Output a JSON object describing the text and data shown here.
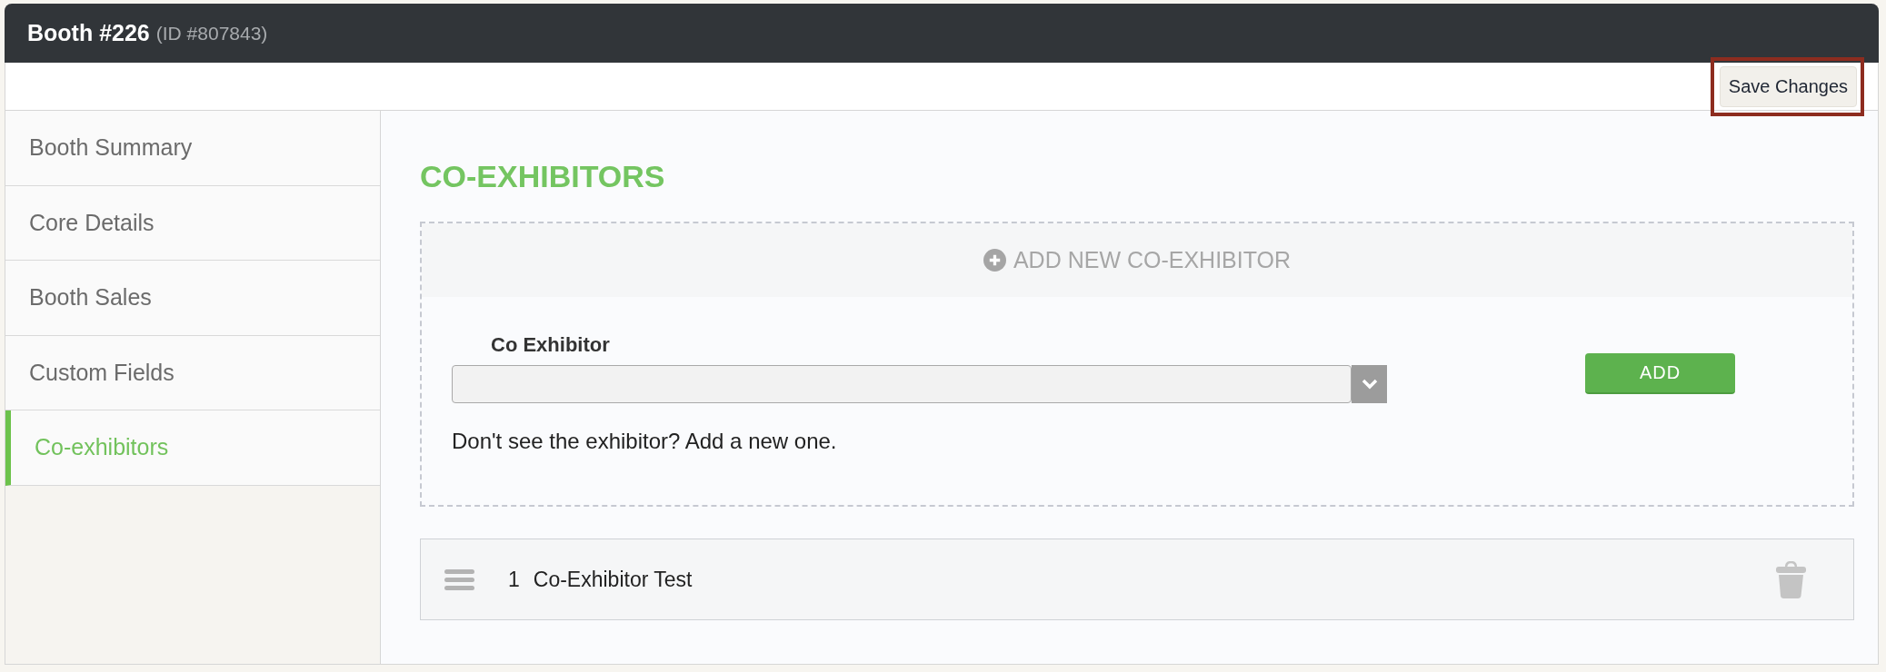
{
  "header": {
    "title": "Booth #226",
    "id_label": "(ID #807843)"
  },
  "save_button": {
    "label": "Save Changes",
    "highlighted": true
  },
  "sidebar": {
    "items": [
      {
        "label": "Booth Summary",
        "selected": false
      },
      {
        "label": "Core Details",
        "selected": false
      },
      {
        "label": "Booth Sales",
        "selected": false
      },
      {
        "label": "Custom Fields",
        "selected": false
      },
      {
        "label": "Co-exhibitors",
        "selected": true
      }
    ]
  },
  "section": {
    "title": "CO-EXHIBITORS"
  },
  "add_panel": {
    "header": "ADD NEW CO-EXHIBITOR",
    "field_label": "Co Exhibitor",
    "help_text": "Don't see the exhibitor? Add a new one.",
    "add_button": "ADD"
  },
  "list": [
    {
      "number": "1",
      "name": "Co-Exhibitor Test"
    }
  ]
}
